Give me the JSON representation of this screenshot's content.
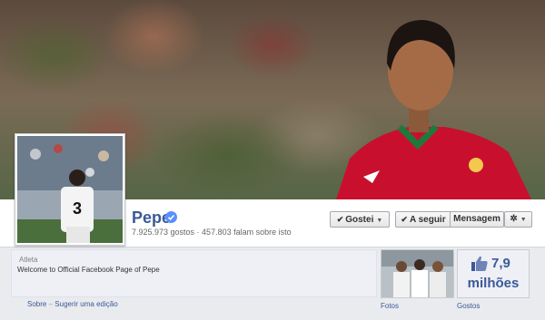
{
  "page": {
    "name": "Pepe",
    "verified": true,
    "stats": "7.925.973 gostos · 457.803 falam sobre isto",
    "category": "Atleta",
    "description": "Welcome to Official Facebook Page of Pepe"
  },
  "actions": {
    "like_label": "Gostei",
    "follow_label": "A seguir",
    "message_label": "Mensagem"
  },
  "about_links": {
    "about": "Sobre",
    "separator": "–",
    "suggest_edit": "Sugerir uma edição"
  },
  "apps": {
    "photos_label": "Fotos",
    "likes_number": "7,9",
    "likes_unit": "milhões",
    "likes_label": "Gostos"
  },
  "icons": {
    "verified": "verified-badge-icon",
    "like_check": "check-icon",
    "settings": "gear-icon",
    "dropdown": "caret-down-icon",
    "likes": "thumbs-up-icon"
  },
  "colors": {
    "link_blue": "#3b5998",
    "verified_blue": "#5890ff",
    "page_bg": "#e9ebee",
    "jersey_red": "#c8102e",
    "jersey_green": "#1e7a3c"
  }
}
